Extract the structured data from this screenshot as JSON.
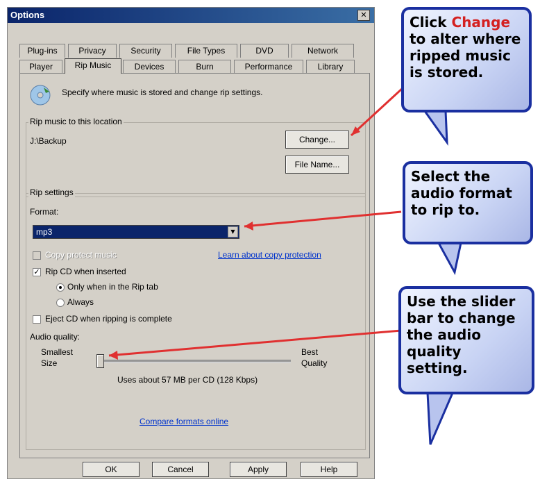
{
  "dialog": {
    "title": "Options",
    "close_glyph": "✕",
    "tabs_row1": [
      "Plug-ins",
      "Privacy",
      "Security",
      "File Types",
      "DVD",
      "Network"
    ],
    "tabs_row2": [
      "Player",
      "Rip Music",
      "Devices",
      "Burn",
      "Performance",
      "Library"
    ],
    "active_tab": "Rip Music",
    "intro_text": "Specify where music is stored and change rip settings.",
    "location_group": {
      "title": "Rip music to this location",
      "path": "J:\\Backup",
      "change_button": "Change...",
      "filename_button": "File Name..."
    },
    "settings_group": {
      "title": "Rip settings",
      "format_label": "Format:",
      "format_value": "mp3",
      "copy_protect_label": "Copy protect music",
      "copy_protect_link": "Learn about copy protection",
      "rip_cd_label": "Rip CD when inserted",
      "only_rip_tab_label": "Only when in the Rip tab",
      "always_label": "Always",
      "eject_label": "Eject CD when ripping is complete",
      "audio_quality_label": "Audio quality:",
      "smallest_size_label_1": "Smallest",
      "smallest_size_label_2": "Size",
      "best_quality_label_1": "Best",
      "best_quality_label_2": "Quality",
      "slider_level": 0,
      "usage_text": "Uses about 57 MB per CD (128 Kbps)",
      "compare_link": "Compare formats online"
    },
    "buttons": {
      "ok": "OK",
      "cancel": "Cancel",
      "apply": "Apply",
      "help": "Help"
    }
  },
  "callouts": {
    "change": {
      "prefix": "Click ",
      "highlight": "Change",
      "rest": "to alter where ripped music is stored."
    },
    "format": "Select the audio format to rip to.",
    "slider": "Use the slider bar to change the audio quality setting."
  },
  "colors": {
    "highlight_red": "#d42020",
    "callout_border": "#1a2fa0",
    "select_bg": "#0a246a",
    "arrow_red": "#e03030"
  }
}
